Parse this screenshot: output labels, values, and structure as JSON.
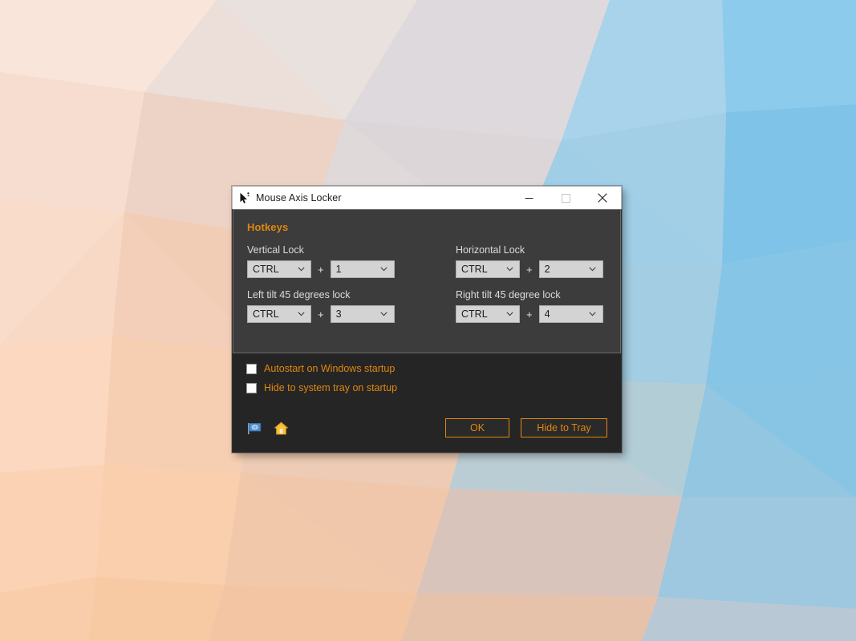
{
  "window": {
    "title": "Mouse Axis Locker",
    "icon": "mouse-cursor-icon",
    "controls": {
      "minimize": "minimize-icon",
      "maximize": "maximize-icon",
      "close": "close-icon"
    }
  },
  "hotkeys": {
    "group_title": "Hotkeys",
    "plus": "+",
    "entries": [
      {
        "label": "Vertical Lock",
        "modifier": "CTRL",
        "key": "1"
      },
      {
        "label": "Horizontal Lock",
        "modifier": "CTRL",
        "key": "2"
      },
      {
        "label": "Left tilt 45 degrees lock",
        "modifier": "CTRL",
        "key": "3"
      },
      {
        "label": "Right tilt 45 degree lock",
        "modifier": "CTRL",
        "key": "4"
      }
    ]
  },
  "options": [
    {
      "label": "Autostart on Windows startup",
      "checked": false
    },
    {
      "label": "Hide to system tray on startup",
      "checked": false
    }
  ],
  "bottom": {
    "icons": [
      {
        "name": "flag-icon"
      },
      {
        "name": "home-icon"
      }
    ],
    "buttons": {
      "ok": "OK",
      "hide_to_tray": "Hide to Tray"
    }
  },
  "colors": {
    "accent_orange": "#e0870f",
    "window_body": "#252525",
    "group_panel": "#3c3c3c",
    "titlebar": "#ffffff",
    "combo_bg": "#d3d3d3",
    "label_text": "#dcdcdc"
  }
}
